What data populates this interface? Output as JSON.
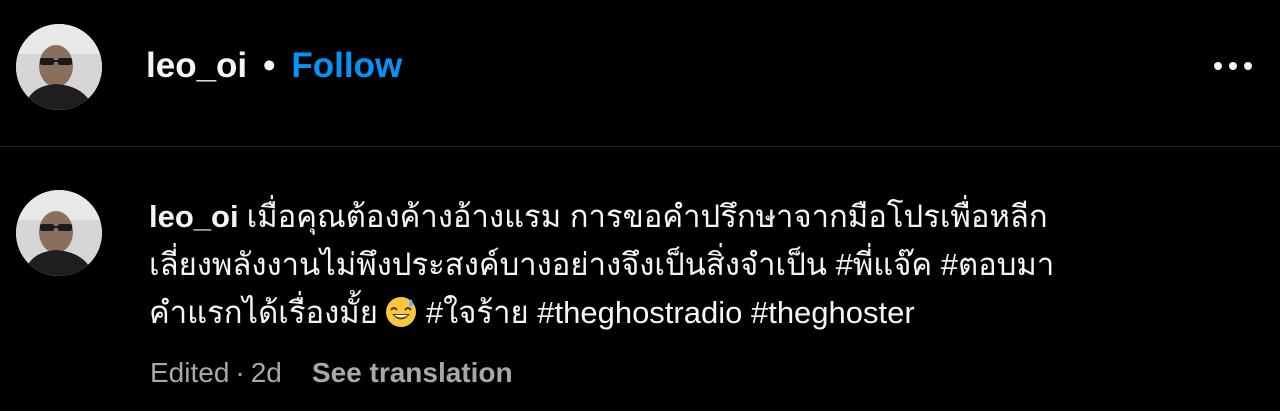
{
  "post": {
    "username": "leo_oi",
    "separator": "•",
    "follow_label": "Follow",
    "more_icon": "more-horizontal-icon"
  },
  "comment": {
    "username": "leo_oi",
    "lines": [
      "เมื่อคุณต้องค้างอ้างแรม การขอคำปรึกษาจากมือโปรเพื่อหลีก",
      "เลี่ยงพลังงานไม่พึงประสงค์บางอย่างจึงเป็นสิ่งจำเป็น #พี่แจ๊ค #ตอบมา",
      "คำแรกได้เรื่องมั้ย"
    ],
    "emoji": "grinning-face-with-sweat-emoji",
    "tail": "#ใจร้าย #theghostradio #theghoster",
    "edited_label": "Edited",
    "dot": "·",
    "age": "2d",
    "see_translation_label": "See translation"
  },
  "colors": {
    "background": "#000000",
    "text": "#f5f5f5",
    "follow_blue": "#0095f6",
    "muted": "#a8a8a8",
    "divider": "#262626"
  }
}
